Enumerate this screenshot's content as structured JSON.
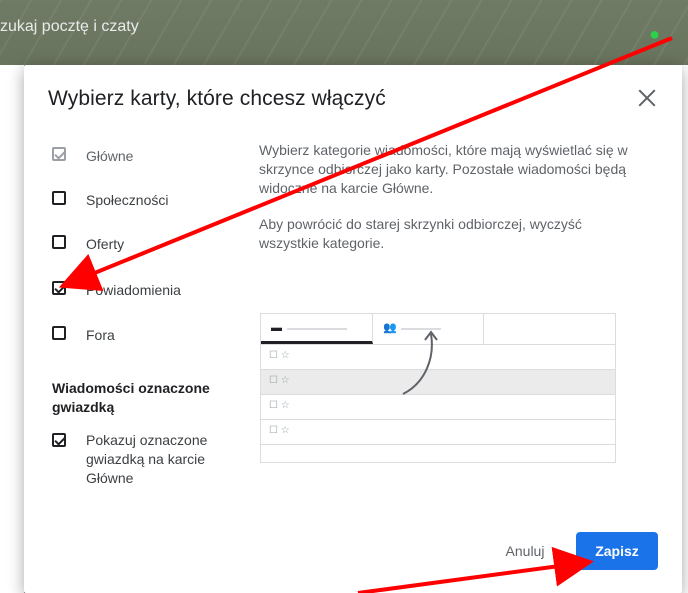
{
  "background": {
    "search_placeholder": "zukaj pocztę i czaty"
  },
  "dialog": {
    "title": "Wybierz karty, które chcesz włączyć",
    "close_icon": "close-icon",
    "options": [
      {
        "label": "Główne",
        "checked": true,
        "disabled": true
      },
      {
        "label": "Społeczności",
        "checked": false,
        "disabled": false
      },
      {
        "label": "Oferty",
        "checked": false,
        "disabled": false
      },
      {
        "label": "Powiadomienia",
        "checked": true,
        "disabled": false
      },
      {
        "label": "Fora",
        "checked": false,
        "disabled": false
      }
    ],
    "starred_section": {
      "heading": "Wiadomości oznaczone gwiazdką",
      "option_label": "Pokazuj oznaczone gwiazdką na karcie Główne",
      "checked": true
    },
    "description": {
      "p1": "Wybierz kategorie wiadomości, które mają wyświetlać się w skrzynce odbiorczej jako karty. Pozostałe wiadomości będą widoczne na karcie Główne.",
      "p2": "Aby powrócić do starej skrzynki odbiorczej, wyczyść wszystkie kategorie."
    },
    "buttons": {
      "cancel": "Anuluj",
      "save": "Zapisz"
    },
    "colors": {
      "save_button": "#1a73e8",
      "annotation_arrow": "#ff0000"
    }
  }
}
